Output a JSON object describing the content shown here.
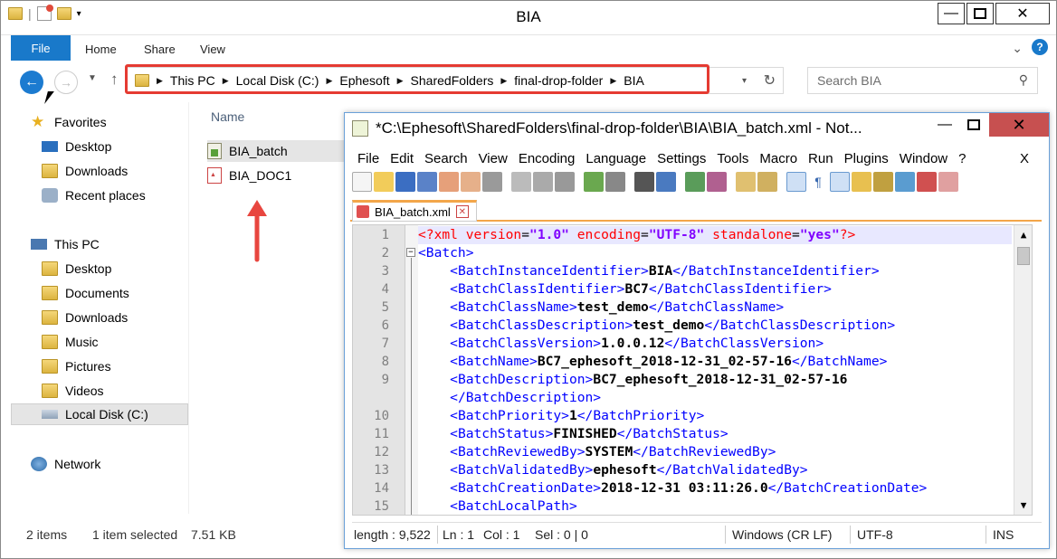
{
  "explorer": {
    "title": "BIA",
    "ribbon_tabs": [
      "File",
      "Home",
      "Share",
      "View"
    ],
    "breadcrumb": [
      "This PC",
      "Local Disk (C:)",
      "Ephesoft",
      "SharedFolders",
      "final-drop-folder",
      "BIA"
    ],
    "search_placeholder": "Search BIA",
    "nav": {
      "favorites": "Favorites",
      "fav_items": [
        "Desktop",
        "Downloads",
        "Recent places"
      ],
      "this_pc": "This PC",
      "pc_items": [
        "Desktop",
        "Documents",
        "Downloads",
        "Music",
        "Pictures",
        "Videos",
        "Local Disk (C:)"
      ],
      "network": "Network"
    },
    "column_header": "Name",
    "files": [
      "BIA_batch",
      "BIA_DOC1"
    ],
    "status": {
      "count": "2 items",
      "selected": "1 item selected",
      "size": "7.51 KB"
    }
  },
  "notepad": {
    "title": "*C:\\Ephesoft\\SharedFolders\\final-drop-folder\\BIA\\BIA_batch.xml - Not...",
    "menu": [
      "File",
      "Edit",
      "Search",
      "View",
      "Encoding",
      "Language",
      "Settings",
      "Tools",
      "Macro",
      "Run",
      "Plugins",
      "Window",
      "?"
    ],
    "menu_close": "X",
    "tab_label": "BIA_batch.xml",
    "lines": [
      {
        "n": "1",
        "pi": "<?xml ",
        "a1": "version",
        "v1": "\"1.0\"",
        "a2": " encoding",
        "v2": "\"UTF-8\"",
        "a3": " standalone",
        "v3": "\"yes\"",
        "end": "?>"
      },
      {
        "n": "2",
        "open": "<Batch>"
      },
      {
        "n": "3",
        "indent": true,
        "open": "<BatchInstanceIdentifier>",
        "text": "BIA",
        "close": "</BatchInstanceIdentifier>"
      },
      {
        "n": "4",
        "indent": true,
        "open": "<BatchClassIdentifier>",
        "text": "BC7",
        "close": "</BatchClassIdentifier>"
      },
      {
        "n": "5",
        "indent": true,
        "open": "<BatchClassName>",
        "text": "test_demo",
        "close": "</BatchClassName>"
      },
      {
        "n": "6",
        "indent": true,
        "open": "<BatchClassDescription>",
        "text": "test_demo",
        "close": "</BatchClassDescription>"
      },
      {
        "n": "7",
        "indent": true,
        "open": "<BatchClassVersion>",
        "text": "1.0.0.12",
        "close": "</BatchClassVersion>"
      },
      {
        "n": "8",
        "indent": true,
        "open": "<BatchName>",
        "text": "BC7_ephesoft_2018-12-31_02-57-16",
        "close": "</BatchName>"
      },
      {
        "n": "9",
        "indent": true,
        "open": "<BatchDescription>",
        "text": "BC7_ephesoft_2018-12-31_02-57-16",
        "close": ""
      },
      {
        "n": "",
        "indent": true,
        "open": "",
        "text": "",
        "close": "</BatchDescription>"
      },
      {
        "n": "10",
        "indent": true,
        "open": "<BatchPriority>",
        "text": "1",
        "close": "</BatchPriority>"
      },
      {
        "n": "11",
        "indent": true,
        "open": "<BatchStatus>",
        "text": "FINISHED",
        "close": "</BatchStatus>"
      },
      {
        "n": "12",
        "indent": true,
        "open": "<BatchReviewedBy>",
        "text": "SYSTEM",
        "close": "</BatchReviewedBy>"
      },
      {
        "n": "13",
        "indent": true,
        "open": "<BatchValidatedBy>",
        "text": "ephesoft",
        "close": "</BatchValidatedBy>"
      },
      {
        "n": "14",
        "indent": true,
        "open": "<BatchCreationDate>",
        "text": "2018-12-31 03:11:26.0",
        "close": "</BatchCreationDate>"
      },
      {
        "n": "15",
        "indent": true,
        "open": "<BatchLocalPath>",
        "text": "",
        "close": ""
      }
    ],
    "status": {
      "length": "length : 9,522",
      "ln": "Ln : 1",
      "col": "Col : 1",
      "sel": "Sel : 0 | 0",
      "eol": "Windows (CR LF)",
      "enc": "UTF-8",
      "mode": "INS"
    }
  },
  "colors": {
    "accent": "#1979ca",
    "highlight_box": "#e53b32",
    "arrow": "#e8463f",
    "tab_accent": "#f3a64a"
  }
}
